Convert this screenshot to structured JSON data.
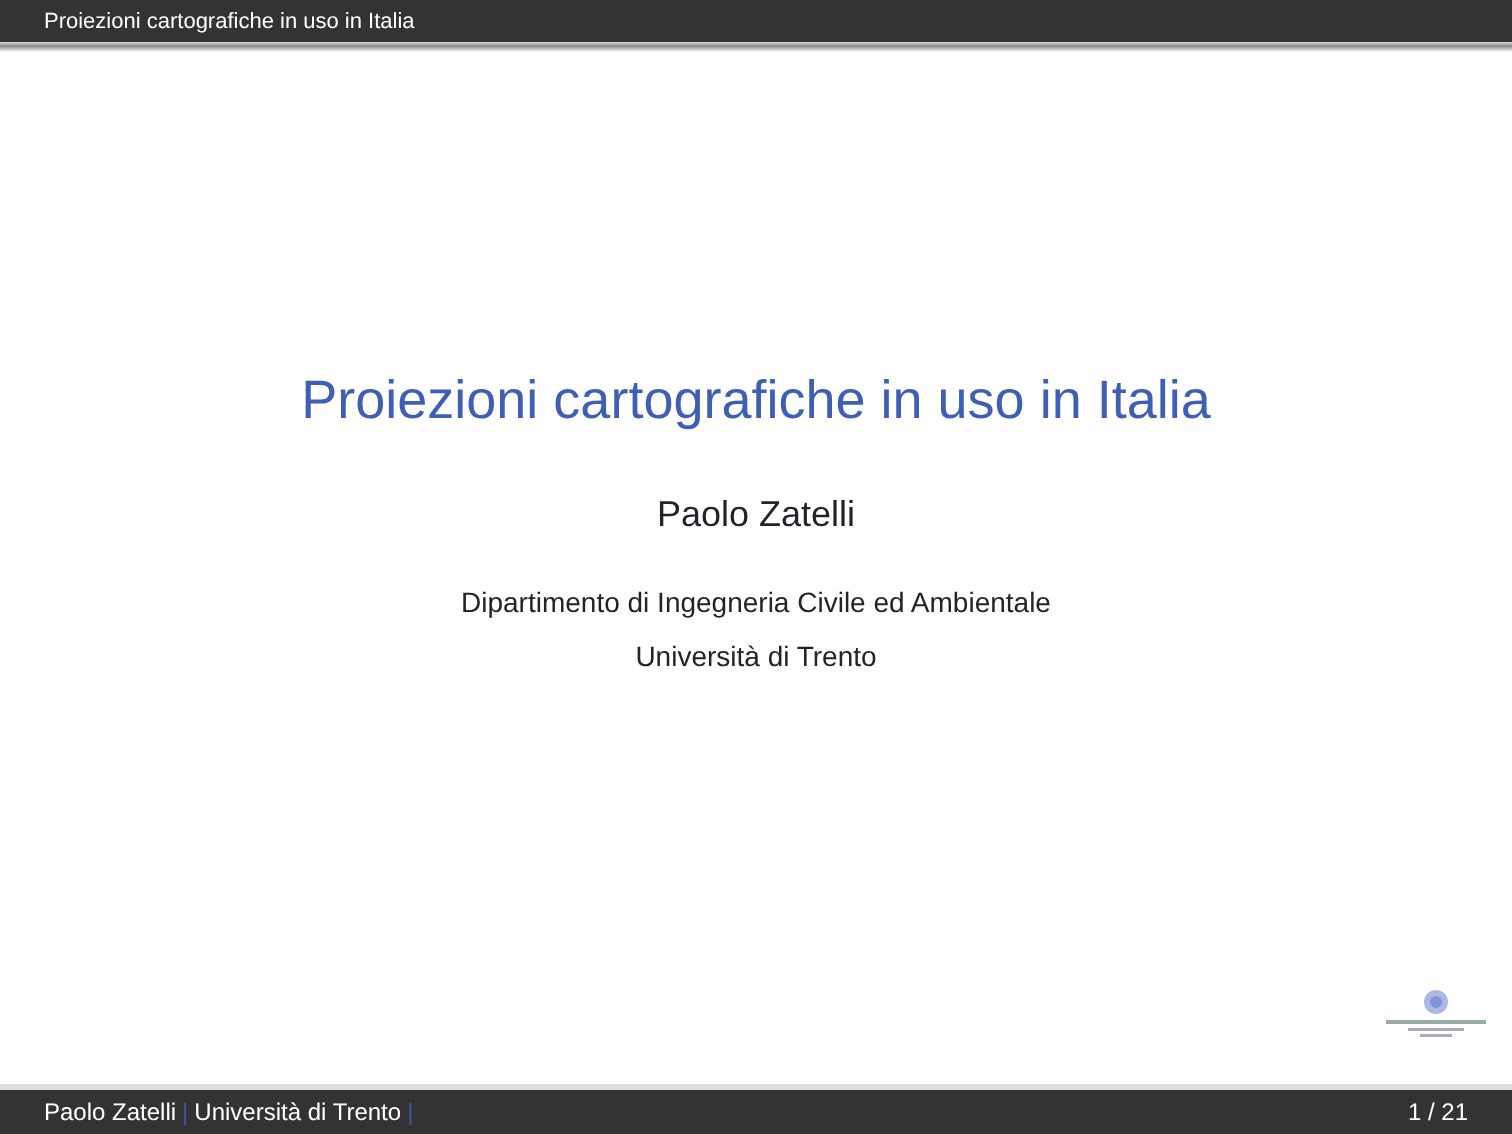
{
  "header": {
    "title": "Proiezioni cartografiche in uso in Italia"
  },
  "slide": {
    "title": "Proiezioni cartografiche in uso in Italia",
    "author": "Paolo Zatelli",
    "institute": [
      "Dipartimento di Ingegneria Civile ed Ambientale",
      "Università di Trento"
    ]
  },
  "footer": {
    "author": "Paolo Zatelli",
    "separator_1": "|",
    "institute": "Università di Trento",
    "separator_2": "|",
    "page": "1 / 21"
  }
}
